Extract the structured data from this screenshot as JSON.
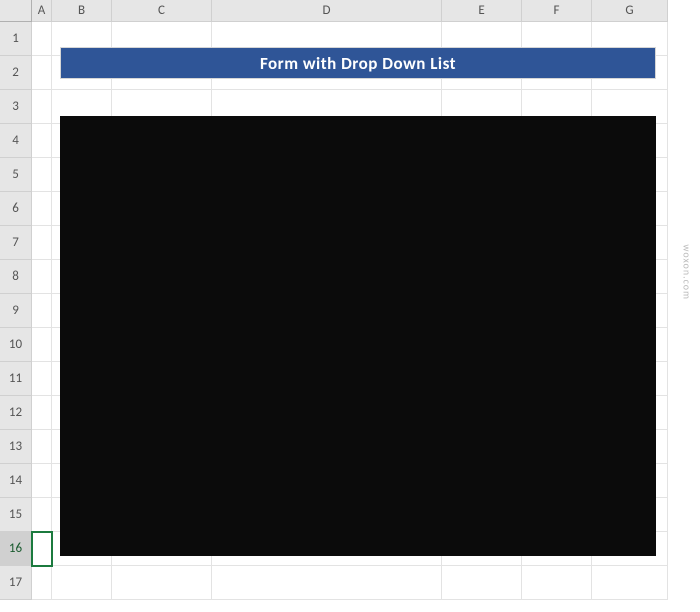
{
  "columns": [
    "A",
    "B",
    "C",
    "D",
    "E",
    "F",
    "G"
  ],
  "rowCount": 17,
  "activeRow": 16,
  "banner": {
    "title": "Form with Drop Down List"
  },
  "watermark": "woxon.com"
}
